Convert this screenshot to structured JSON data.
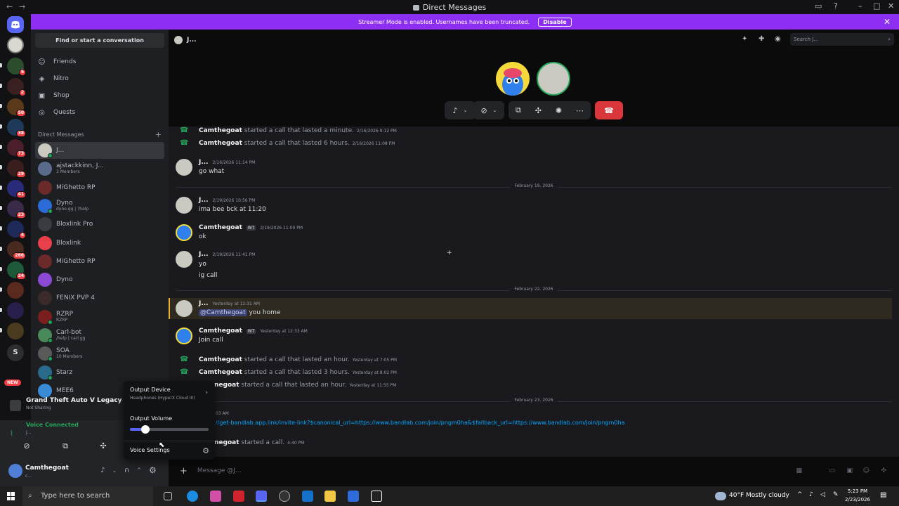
{
  "titlebar": {
    "title": "Direct Messages",
    "back": "←",
    "forward": "→"
  },
  "banner": {
    "text": "Streamer Mode is enabled. Usernames have been truncated.",
    "disable_label": "Disable",
    "close": "✕"
  },
  "guild_badges": [
    "5",
    "2",
    "50",
    "38",
    "73",
    "29",
    "41",
    "23",
    "4",
    "266",
    "24"
  ],
  "guild_labels": {
    "s": "S",
    "new": "NEW"
  },
  "sidebar": {
    "find_placeholder": "Find or start a conversation",
    "nav": [
      {
        "label": "Friends",
        "icon": "friends-icon"
      },
      {
        "label": "Nitro",
        "icon": "nitro-icon"
      },
      {
        "label": "Shop",
        "icon": "shop-icon"
      },
      {
        "label": "Quests",
        "icon": "quests-icon"
      }
    ],
    "dm_header": "Direct Messages",
    "dms": [
      {
        "name": "J...",
        "sub": ""
      },
      {
        "name": "ajstackkinn, J...",
        "sub": "3 Members"
      },
      {
        "name": "MiGhetto RP",
        "sub": ""
      },
      {
        "name": "Dyno",
        "sub": "dyno.gg | ?help"
      },
      {
        "name": "Bloxlink Pro",
        "sub": ""
      },
      {
        "name": "Bloxlink",
        "sub": ""
      },
      {
        "name": "MiGhetto RP",
        "sub": ""
      },
      {
        "name": "Dyno",
        "sub": ""
      },
      {
        "name": "FENIX PVP 4",
        "sub": ""
      },
      {
        "name": "RZRP",
        "sub": "RZRP"
      },
      {
        "name": "Carl-bot",
        "sub": "/help | carl.gg"
      },
      {
        "name": "SOA",
        "sub": "10 Members"
      },
      {
        "name": "Starz",
        "sub": ""
      },
      {
        "name": "MEE6",
        "sub": ""
      }
    ]
  },
  "game": {
    "title": "Grand Theft Auto V Legacy",
    "sub": "Not Sharing"
  },
  "voice": {
    "status": "Voice Connected",
    "channel": "J..."
  },
  "user": {
    "name": "Camthegoat",
    "status": "c..."
  },
  "popup": {
    "output_device_label": "Output Device",
    "output_device_value": "Headphones (HyperX Cloud III)",
    "output_volume_label": "Output Volume",
    "output_volume_level": 0.2,
    "voice_settings_label": "Voice Settings"
  },
  "dm_title": "J...",
  "search_placeholder": "Search J...",
  "messages": {
    "sys1": {
      "author": "Camthegoat",
      "text": "started a call that lasted a minute.",
      "ts": "2/16/2026 9:12 PM"
    },
    "sys2": {
      "author": "Camthegoat",
      "text": "started a call that lasted 6 hours.",
      "ts": "2/16/2026 11:08 PM"
    },
    "m1": {
      "author": "J...",
      "ts": "2/16/2026 11:14 PM",
      "text": "go what"
    },
    "div1": "February 19, 2026",
    "m2": {
      "author": "J...",
      "ts": "2/19/2026 10:56 PM",
      "text": "ima bee bck at 11:20"
    },
    "m3": {
      "author": "Camthegoat",
      "tag": "WT",
      "ts": "2/19/2026 11:00 PM",
      "text": "ok"
    },
    "m4": {
      "author": "J...",
      "ts": "2/19/2026 11:41 PM",
      "text": "yo",
      "text2": "ig call"
    },
    "div2": "February 22, 2026",
    "m5": {
      "author": "J...",
      "ts": "Yesterday at 12:31 AM",
      "mention": "@Camthegoat",
      "text": "you home"
    },
    "m6": {
      "author": "Camthegoat",
      "tag": "WT",
      "ts": "Yesterday at 12:33 AM",
      "text": "Join call"
    },
    "sys3": {
      "author": "Camthegoat",
      "text": "started a call that lasted an hour.",
      "ts": "Yesterday at 7:05 PM"
    },
    "sys4": {
      "author": "Camthegoat",
      "text": "started a call that lasted 3 hours.",
      "ts": "Yesterday at 8:02 PM"
    },
    "sys5": {
      "author": "negoat",
      "text": "started a call that lasted an hour.",
      "ts": "Yesterday at 11:55 PM"
    },
    "div3": "February 23, 2026",
    "m7": {
      "ts": "03 AM",
      "link": "//get-bandlab.app.link/invite-link?$canonical_url=https://www.bandlab.com/join/pngm0ha&$fallback_url=https://www.bandlab.com/join/pngm0ha"
    },
    "sys6": {
      "author": "negoat",
      "text": "started a call.",
      "ts": "4:40 PM"
    }
  },
  "composer_placeholder": "Message @J...",
  "taskbar": {
    "search": "Type here to search",
    "weather": "40°F  Mostly cloudy",
    "time": "5:23 PM",
    "date": "2/23/2026"
  },
  "colors": {
    "accent": "#5865f2",
    "banner": "#8c2ff2",
    "hangup": "#da373c",
    "online": "#23a55a",
    "mention_highlight": "#f0b232"
  }
}
